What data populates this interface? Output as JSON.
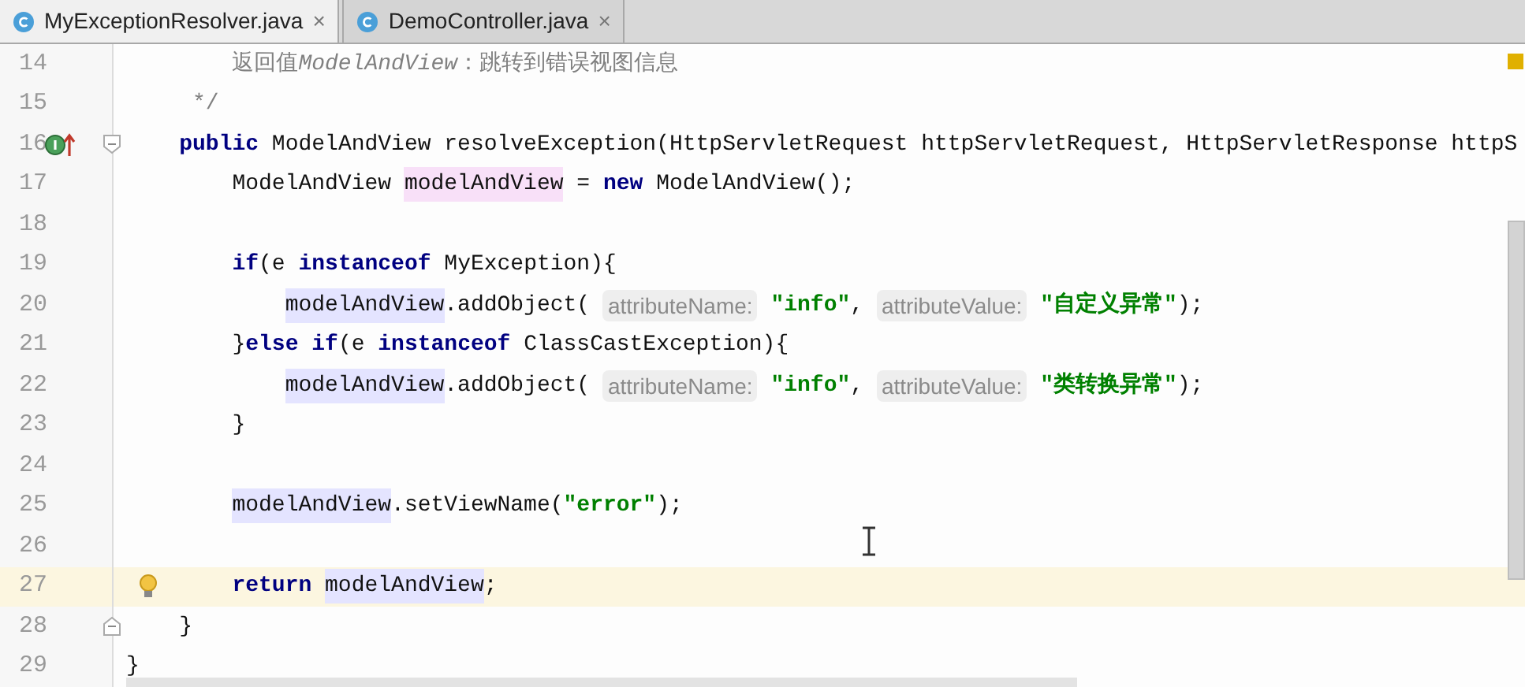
{
  "tabs": [
    {
      "label": "MyExceptionResolver.java",
      "close": "×",
      "selected": true
    },
    {
      "label": "DemoController.java",
      "close": "×",
      "selected": false
    }
  ],
  "lines": [
    {
      "number": "14",
      "tokens": [
        {
          "kind": "comment",
          "text": "        返回值"
        },
        {
          "kind": "comment_it",
          "text": "ModelAndView"
        },
        {
          "kind": "comment",
          "text": "：跳转到错误视图信息"
        }
      ]
    },
    {
      "number": "15",
      "tokens": [
        {
          "kind": "comment",
          "text": "     */"
        }
      ]
    },
    {
      "number": "16",
      "gutter_icon": {
        "kind": "implements"
      },
      "fold": {
        "kind": "start"
      },
      "tokens": [
        {
          "kind": "kw",
          "text": "    public"
        },
        {
          "kind": "plain",
          "text": " ModelAndView resolveException(HttpServletRequest httpServletRequest, HttpServletResponse httpS"
        }
      ]
    },
    {
      "number": "17",
      "tokens": [
        {
          "kind": "plain",
          "text": "        ModelAndView "
        },
        {
          "kind": "decl",
          "text": "modelAndView"
        },
        {
          "kind": "plain",
          "text": " = "
        },
        {
          "kind": "kw",
          "text": "new"
        },
        {
          "kind": "plain",
          "text": " ModelAndView();"
        }
      ]
    },
    {
      "number": "18"
    },
    {
      "number": "19",
      "tokens": [
        {
          "kind": "kw",
          "text": "        if"
        },
        {
          "kind": "plain",
          "text": "(e "
        },
        {
          "kind": "kw",
          "text": "instanceof"
        },
        {
          "kind": "plain",
          "text": " MyException){"
        }
      ]
    },
    {
      "number": "20",
      "tokens": [
        {
          "kind": "var",
          "text": "            modelAndView"
        },
        {
          "kind": "plain",
          "text": ".addObject( "
        },
        {
          "kind": "hint",
          "text": "attributeName:"
        },
        {
          "kind": "str",
          "text": " \"info\""
        },
        {
          "kind": "plain",
          "text": ", "
        },
        {
          "kind": "hint",
          "text": "attributeValue:"
        },
        {
          "kind": "str",
          "text": " \"自定义异常\""
        },
        {
          "kind": "plain",
          "text": ");"
        }
      ]
    },
    {
      "number": "21",
      "tokens": [
        {
          "kind": "plain",
          "text": "        }"
        },
        {
          "kind": "kw",
          "text": "else if"
        },
        {
          "kind": "plain",
          "text": "(e "
        },
        {
          "kind": "kw",
          "text": "instanceof"
        },
        {
          "kind": "plain",
          "text": " ClassCastException){"
        }
      ]
    },
    {
      "number": "22",
      "tokens": [
        {
          "kind": "var",
          "text": "            modelAndView"
        },
        {
          "kind": "plain",
          "text": ".addObject( "
        },
        {
          "kind": "hint",
          "text": "attributeName:"
        },
        {
          "kind": "str",
          "text": " \"info\""
        },
        {
          "kind": "plain",
          "text": ", "
        },
        {
          "kind": "hint",
          "text": "attributeValue:"
        },
        {
          "kind": "str",
          "text": " \"类转换异常\""
        },
        {
          "kind": "plain",
          "text": ");"
        }
      ]
    },
    {
      "number": "23",
      "tokens": [
        {
          "kind": "plain",
          "text": "        }"
        }
      ]
    },
    {
      "number": "24"
    },
    {
      "number": "25",
      "tokens": [
        {
          "kind": "var",
          "text": "        modelAndView"
        },
        {
          "kind": "plain",
          "text": ".setViewName("
        },
        {
          "kind": "str",
          "text": "\"error\""
        },
        {
          "kind": "plain",
          "text": ");"
        }
      ]
    },
    {
      "number": "26"
    },
    {
      "number": "27",
      "current": true,
      "gutter_icon": {
        "kind": "bulb"
      },
      "tokens": [
        {
          "kind": "kw",
          "text": "        return "
        },
        {
          "kind": "var",
          "text": "modelAndView"
        },
        {
          "kind": "plain",
          "text": ";"
        }
      ]
    },
    {
      "number": "28",
      "fold": {
        "kind": "end"
      },
      "tokens": [
        {
          "kind": "plain",
          "text": "    }"
        }
      ]
    },
    {
      "number": "29",
      "tokens": [
        {
          "kind": "plain",
          "text": "}"
        }
      ]
    }
  ]
}
